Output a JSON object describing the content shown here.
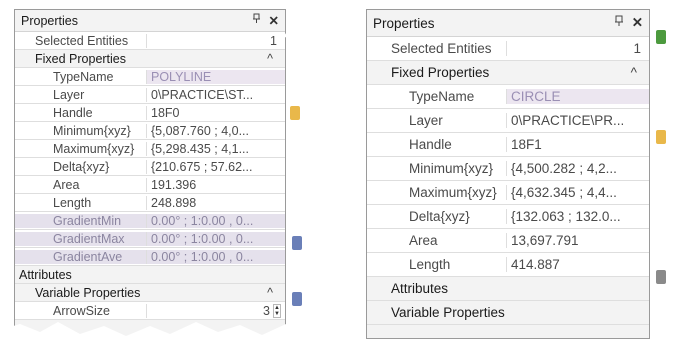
{
  "left_panel": {
    "title": "Properties",
    "selected_entities": {
      "label": "Selected Entities",
      "value": "1"
    },
    "fixed": {
      "label": "Fixed Properties",
      "rows": [
        {
          "name": "TypeName",
          "value": "POLYLINE"
        },
        {
          "name": "Layer",
          "value": "0\\PRACTICE\\ST..."
        },
        {
          "name": "Handle",
          "value": "18F0"
        },
        {
          "name": "Minimum{xyz}",
          "value": "{5,087.760 ; 4,0..."
        },
        {
          "name": "Maximum{xyz}",
          "value": "{5,298.435 ; 4,1..."
        },
        {
          "name": "Delta{xyz}",
          "value": "{210.675 ; 57.62..."
        },
        {
          "name": "Area",
          "value": "191.396"
        },
        {
          "name": "Length",
          "value": "248.898"
        },
        {
          "name": "GradientMin",
          "value": "0.00° ; 1:0.00 , 0..."
        },
        {
          "name": "GradientMax",
          "value": "0.00° ; 1:0.00 , 0..."
        },
        {
          "name": "GradientAve",
          "value": "0.00° ; 1:0.00 , 0..."
        }
      ]
    },
    "attributes_label": "Attributes",
    "variable": {
      "label": "Variable Properties",
      "rows": [
        {
          "name": "ArrowSize",
          "value": "3"
        }
      ]
    }
  },
  "right_panel": {
    "title": "Properties",
    "selected_entities": {
      "label": "Selected Entities",
      "value": "1"
    },
    "fixed": {
      "label": "Fixed Properties",
      "rows": [
        {
          "name": "TypeName",
          "value": "CIRCLE"
        },
        {
          "name": "Layer",
          "value": "0\\PRACTICE\\PR..."
        },
        {
          "name": "Handle",
          "value": "18F1"
        },
        {
          "name": "Minimum{xyz}",
          "value": "{4,500.282 ; 4,2..."
        },
        {
          "name": "Maximum{xyz}",
          "value": "{4,632.345 ; 4,4..."
        },
        {
          "name": "Delta{xyz}",
          "value": "{132.063 ; 132.0..."
        },
        {
          "name": "Area",
          "value": "13,697.791"
        },
        {
          "name": "Length",
          "value": "414.887"
        }
      ]
    },
    "attributes_label": "Attributes",
    "variable": {
      "label": "Variable Properties"
    }
  },
  "icons": {
    "pin": "pin-icon",
    "close": "close-icon",
    "collapse": "chevron-up-icon"
  }
}
